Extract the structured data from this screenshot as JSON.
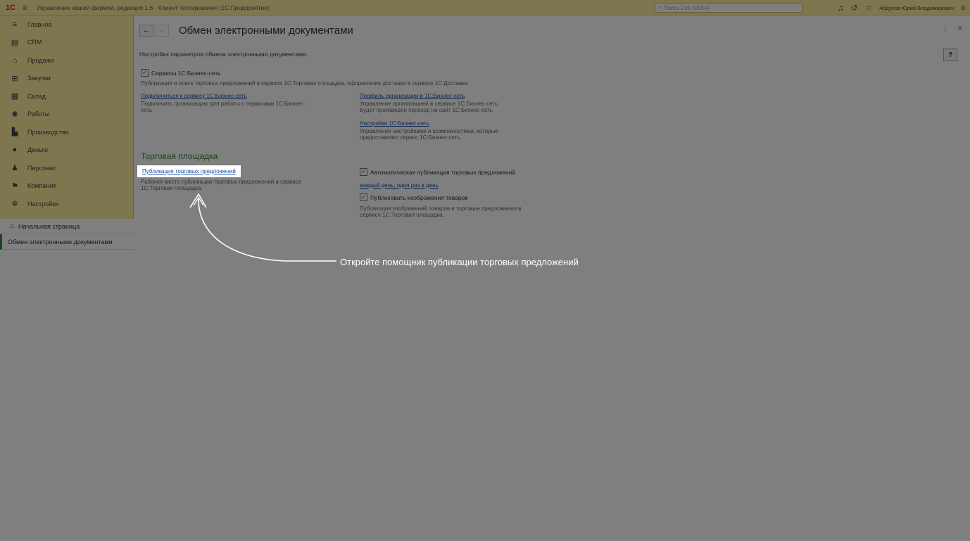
{
  "titlebar": {
    "logo": "1С",
    "title": "Управление нашей фирмой, редакция 1.6 - Клиент тестирования (1С:Предприятие)",
    "search_placeholder": "Поиск Ctrl+Shift+F",
    "user": "Абдулов Юрий Владимирович"
  },
  "sidebar": {
    "items": [
      {
        "label": "Главное",
        "icon": "menu-icon"
      },
      {
        "label": "CRM",
        "icon": "crm-icon"
      },
      {
        "label": "Продажи",
        "icon": "sales-icon"
      },
      {
        "label": "Закупки",
        "icon": "purchases-icon"
      },
      {
        "label": "Склад",
        "icon": "warehouse-icon"
      },
      {
        "label": "Работы",
        "icon": "works-icon"
      },
      {
        "label": "Производство",
        "icon": "production-icon"
      },
      {
        "label": "Деньги",
        "icon": "money-icon"
      },
      {
        "label": "Персонал",
        "icon": "staff-icon"
      },
      {
        "label": "Компания",
        "icon": "company-icon"
      },
      {
        "label": "Настройки",
        "icon": "settings-icon"
      }
    ],
    "home": "Начальная страница",
    "open_tab": "Обмен электронными документами"
  },
  "main": {
    "title": "Обмен электронными документами",
    "help": "?",
    "description": "Настройка параметров обмена электронными документами.",
    "services_checkbox": "Сервисы 1С:Бизнес-сеть",
    "services_desc": "Публикация и поиск торговых предложений в сервисе 1С:Торговая площадка, оформление доставки в сервисе 1С:Доставка.",
    "connect_link": "Подключиться к сервису 1С:Бизнес-сеть",
    "connect_desc_1": "Подключить организацию для работы с сервисами 1С:Бизнес-",
    "connect_desc_2": "сеть",
    "profile_link": "Профиль организации в 1С:Бизнес-сеть",
    "profile_desc_1": "Управление организацией в сервисе 1С:Бизнес-сеть.",
    "profile_desc_2": "Будет произведен переход на сайт 1С:Бизнес-сеть",
    "settings_link": "Настройки 1С:Бизнес-сеть",
    "settings_desc_1": "Управление настройками и возможностями, которые",
    "settings_desc_2": "предоставляет сервис 1С:Бизнес-сеть.",
    "section_title": "Торговая площадка",
    "publish_link": "Публикация торговых предложений",
    "publish_desc_1": "Рабочее место публикации торговых предложений в сервисе",
    "publish_desc_2": "1С:Торговая площадка.",
    "auto_publish": "Автоматическая публикация торговых предложений",
    "schedule_link": "каждый день; один раз в день",
    "publish_images": "Публиковать изображения товаров",
    "images_desc_1": "Публикация изображений товаров в торговые предложения в",
    "images_desc_2": "сервисе 1С:Торговая площадка."
  },
  "tutorial": {
    "hint": "Откройте помощник публикации торговых предложений"
  },
  "colors": {
    "panel": "#fbed9e",
    "link": "#1a4fa8",
    "section": "#3a7a3a",
    "check": "#2a9a2a"
  }
}
